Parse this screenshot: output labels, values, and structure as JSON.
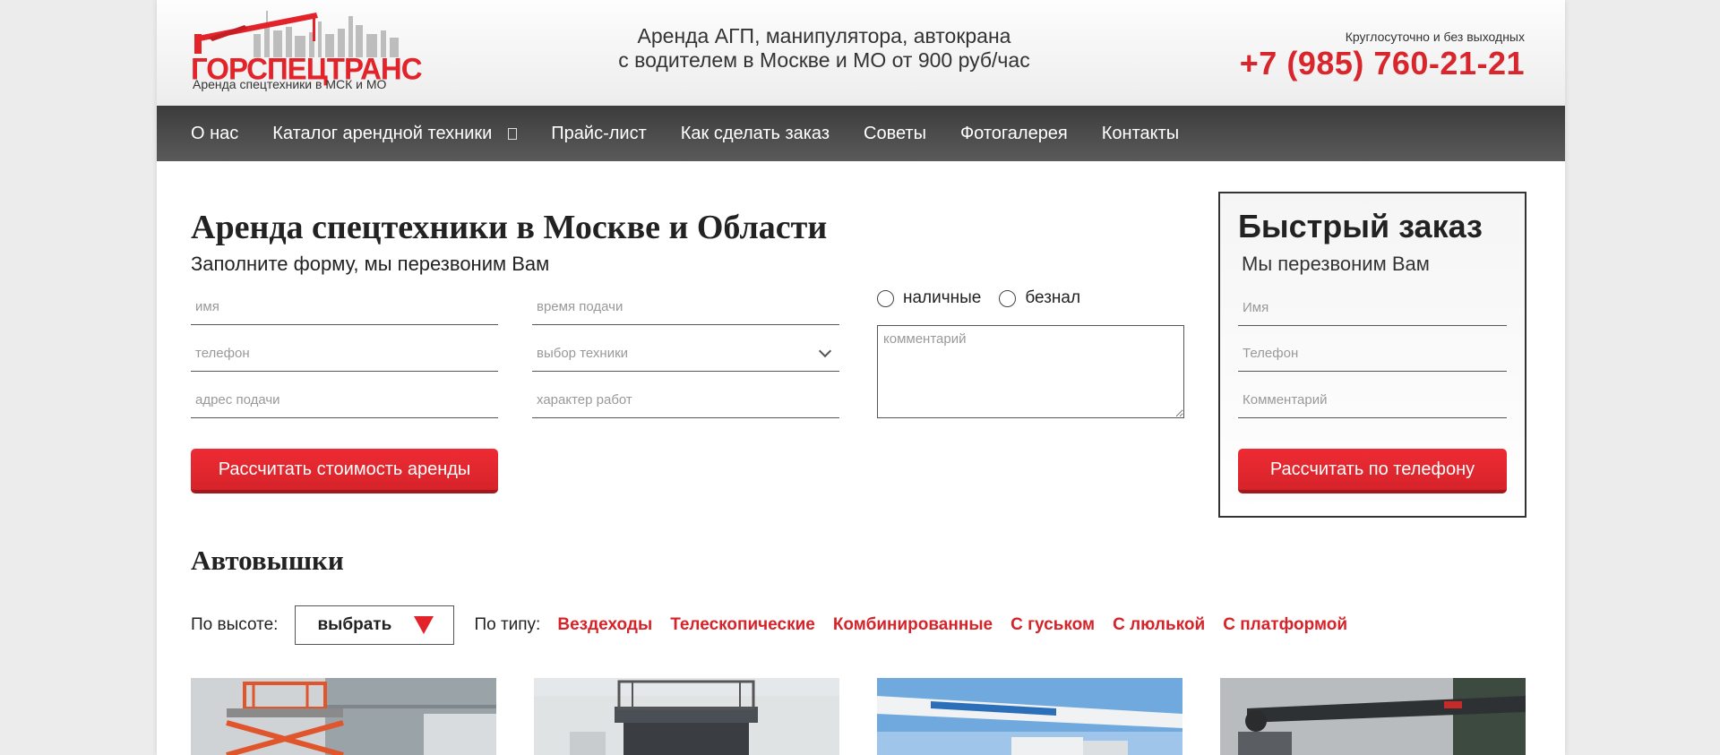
{
  "header": {
    "logo_text": "ГОРСПЕЦТРАНС",
    "logo_sub": "Аренда спецтехники в МСК и МО",
    "tagline_line1": "Аренда АГП, манипулятора, автокрана",
    "tagline_line2": "с водителем в Москве и МО от 900 руб/час",
    "contact_note": "Круглосуточно и без выходных",
    "phone": "+7 (985) 760-21-21"
  },
  "nav": {
    "items": [
      {
        "label": "О нас"
      },
      {
        "label": "Каталог арендной техники"
      },
      {
        "label": "Прайс-лист"
      },
      {
        "label": "Как сделать заказ"
      },
      {
        "label": "Советы"
      },
      {
        "label": "Фотогалерея"
      },
      {
        "label": "Контакты"
      }
    ]
  },
  "order_form": {
    "title": "Аренда спецтехники в Москве и Области",
    "subtitle": "Заполните форму, мы перезвоним Вам",
    "name_placeholder": "имя",
    "phone_placeholder": "телефон",
    "address_placeholder": "адрес подачи",
    "time_placeholder": "время подачи",
    "equipment_placeholder": "выбор техники",
    "work_placeholder": "характер работ",
    "payment_cash": "наличные",
    "payment_cashless": "безнал",
    "comment_placeholder": "комментарий",
    "submit_label": "Рассчитать стоимость аренды"
  },
  "quick_order": {
    "title": "Быстрый заказ",
    "subtitle": "Мы перезвоним Вам",
    "name_placeholder": "Имя",
    "phone_placeholder": "Телефон",
    "comment_placeholder": "Комментарий",
    "submit_label": "Рассчитать по телефону"
  },
  "section": {
    "title": "Автовышки",
    "height_label": "По высоте:",
    "height_select": "выбрать",
    "type_label": "По типу:",
    "type_links": [
      "Вездеходы",
      "Телескопические",
      "Комбинированные",
      "С гуськом",
      "С люлькой",
      "С платформой"
    ]
  },
  "colors": {
    "accent": "#e3232a",
    "nav_bg": "#4a4a4a"
  }
}
